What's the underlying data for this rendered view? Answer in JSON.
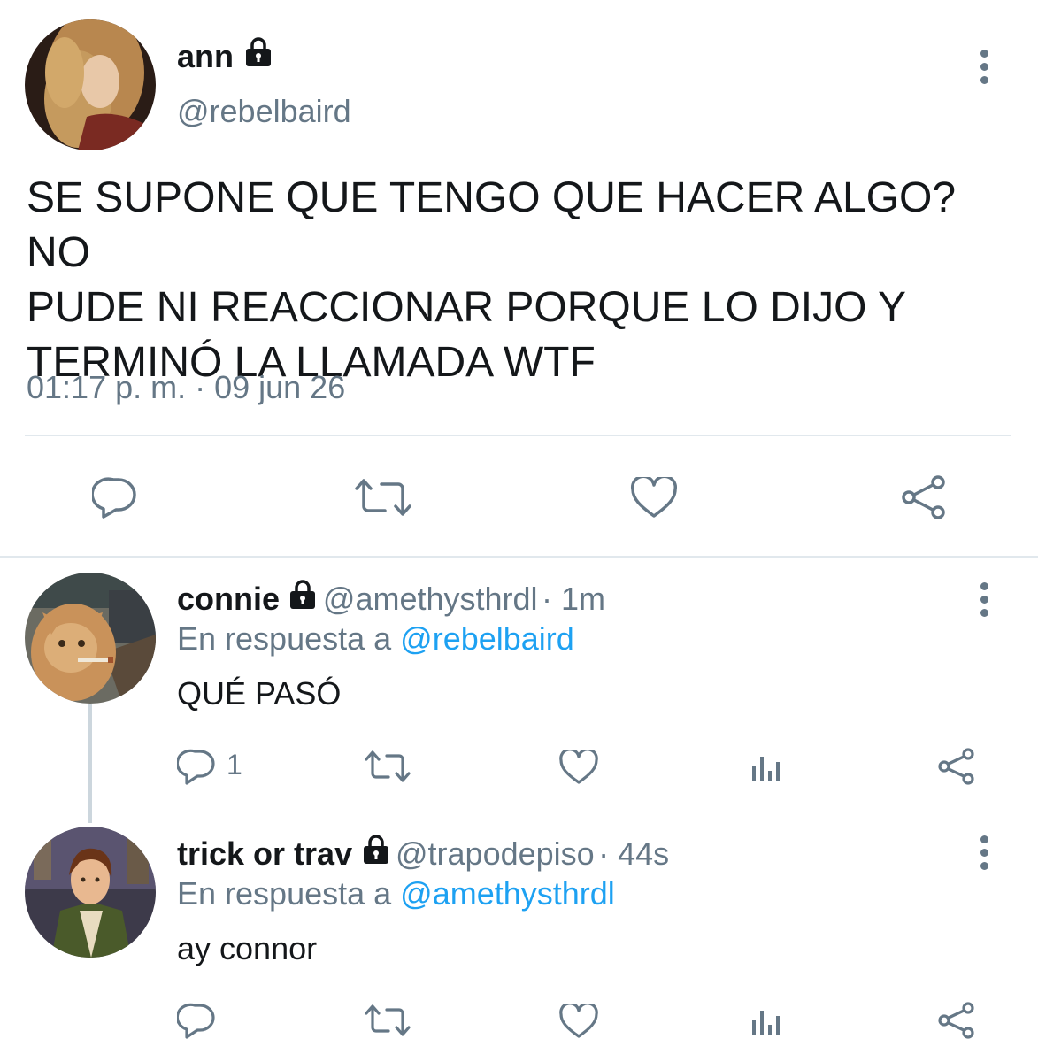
{
  "main_tweet": {
    "display_name": "ann",
    "handle": "@rebelbaird",
    "text_lines": [
      "SE SUPONE QUE TENGO QUE HACER ALGO? NO",
      "PUDE NI REACCIONAR PORQUE LO DIJO Y",
      "TERMINÓ LA LLAMADA WTF"
    ],
    "timestamp": "01:17 p. m. · 09 jun 26"
  },
  "replies": [
    {
      "display_name": "connie",
      "handle": "@amethysthrdl",
      "age": "· 1m",
      "reply_prefix": "En respuesta a",
      "reply_to": "@rebelbaird",
      "text": "QUÉ PASÓ",
      "reply_count": "1"
    },
    {
      "display_name": "trick or trav",
      "handle": "@trapodepiso",
      "age": "· 44s",
      "reply_prefix": "En respuesta a",
      "reply_to": "@amethysthrdl",
      "text": "ay connor",
      "reply_count": ""
    }
  ],
  "icons": {
    "reply": "speech-bubble-icon",
    "retweet": "retweet-arrows-icon",
    "like": "heart-icon",
    "share": "share-nodes-icon",
    "analytics": "bar-chart-icon",
    "protected": "lock-icon",
    "more": "vertical-ellipsis-icon"
  },
  "colors": {
    "text": "#14171a",
    "secondary": "#657786",
    "link": "#1da1f2",
    "divider": "#e1e8ed"
  }
}
